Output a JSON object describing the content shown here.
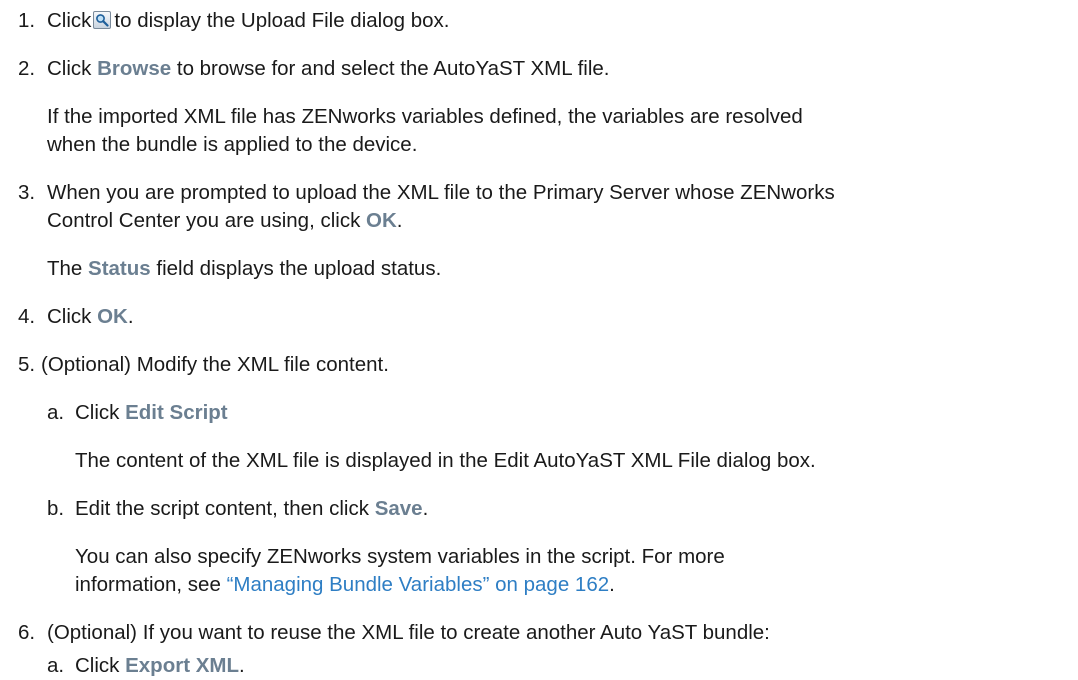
{
  "steps": [
    {
      "num": "1.",
      "pre": "Click",
      "icon": "search-icon",
      "post": "to display the Upload File dialog box."
    },
    {
      "num": "2.",
      "pre": "Click ",
      "ui": "Browse",
      "post": " to browse for and select the AutoYaST XML file.",
      "note_lines": [
        "If the imported XML file has ZENworks variables defined, the variables are resolved",
        "when the bundle is applied to the device."
      ]
    },
    {
      "num": "3.",
      "line1": "When you are prompted to upload the XML file to the Primary Server whose ZENworks",
      "line2_pre": "Control Center you are using, click ",
      "line2_ui": "OK",
      "line2_post": ".",
      "note_pre": "The ",
      "note_ui": "Status",
      "note_post": " field displays the upload status."
    },
    {
      "num": "4.",
      "pre": "Click ",
      "ui": "OK",
      "post": "."
    },
    {
      "num": "5.",
      "text": " (Optional) Modify the XML file content.",
      "substeps": [
        {
          "letter": "a.",
          "pre": "Click ",
          "ui": "Edit Script",
          "note": "The content of the XML file is displayed in the Edit AutoYaST XML File dialog box."
        },
        {
          "letter": "b.",
          "pre": "Edit the script content, then click ",
          "ui": "Save",
          "post": ".",
          "note_line1": "You can also specify ZENworks system variables in the script. For more",
          "note_line2_pre": "information, see ",
          "note_link": "“Managing Bundle Variables” on page 162",
          "note_line2_post": "."
        }
      ]
    },
    {
      "num": "6.",
      "text": "(Optional) If you want to reuse the XML file to create another Auto YaST bundle:",
      "substeps": [
        {
          "letter": "a.",
          "pre": "Click ",
          "ui": "Export XML",
          "post": "."
        }
      ]
    }
  ]
}
